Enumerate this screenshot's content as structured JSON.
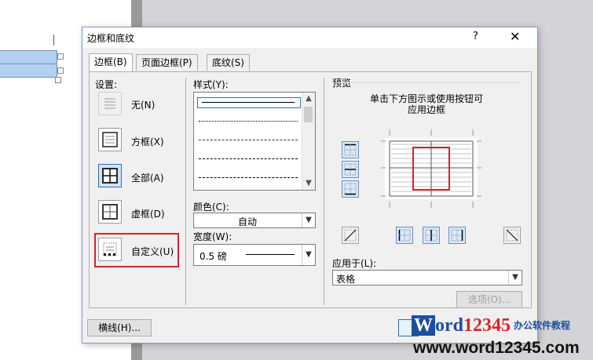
{
  "dialog": {
    "title": "边框和底纹",
    "help_label": "?",
    "close_label": "✕"
  },
  "tabs": [
    {
      "label": "边框(B)",
      "active": true
    },
    {
      "label": "页面边框(P)",
      "active": false
    },
    {
      "label": "底纹(S)",
      "active": false
    }
  ],
  "settings": {
    "heading": "设置:",
    "items": [
      {
        "label": "无(N)",
        "icon": "no-border-icon"
      },
      {
        "label": "方框(X)",
        "icon": "box-border-icon"
      },
      {
        "label": "全部(A)",
        "icon": "all-borders-icon"
      },
      {
        "label": "虚框(D)",
        "icon": "grid-border-icon"
      },
      {
        "label": "自定义(U)",
        "icon": "custom-border-icon"
      }
    ]
  },
  "style": {
    "heading": "样式(Y):",
    "items": [
      "solid",
      "dotted",
      "dense-dashed",
      "dashed",
      "dash-dot"
    ]
  },
  "color": {
    "heading": "颜色(C):",
    "value": "自动"
  },
  "width": {
    "heading": "宽度(W):",
    "value": "0.5 磅"
  },
  "preview": {
    "heading": "预览",
    "description_line1": "单击下方图示或使用按钮可",
    "description_line2": "应用边框"
  },
  "apply_to": {
    "heading": "应用于(L):",
    "value": "表格"
  },
  "buttons": {
    "options": "选项(O)...",
    "horizontal_line": "横线(H)..."
  },
  "watermark": {
    "word": "W",
    "ord": "ord",
    "number": "12345",
    "chinese": "办公软件教程",
    "url": "www.word12345.com"
  },
  "colors": {
    "accent": "#3a6ea5",
    "highlight_red": "#d0262b",
    "table_selection": "#b5cff0"
  }
}
